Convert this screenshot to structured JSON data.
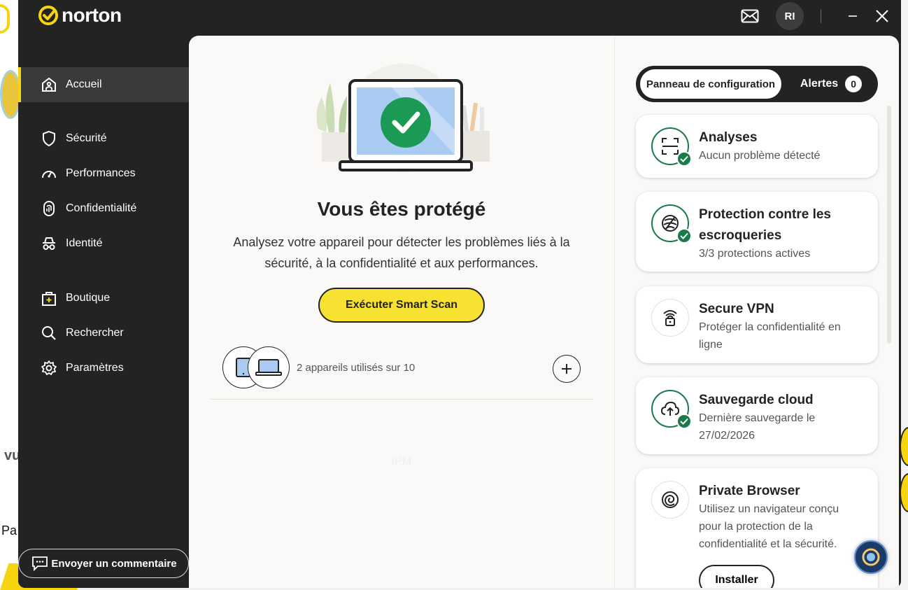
{
  "app": {
    "brand": "norton",
    "user_initials": "RI"
  },
  "sidebar": {
    "items": [
      {
        "label": "Accueil",
        "icon": "home-icon"
      },
      {
        "label": "Sécurité",
        "icon": "shield-icon"
      },
      {
        "label": "Performances",
        "icon": "speedometer-icon"
      },
      {
        "label": "Confidentialité",
        "icon": "fingerprint-icon"
      },
      {
        "label": "Identité",
        "icon": "incognito-icon"
      },
      {
        "label": "Boutique",
        "icon": "shopping-bag-icon"
      },
      {
        "label": "Rechercher",
        "icon": "search-icon"
      },
      {
        "label": "Paramètres",
        "icon": "gear-icon"
      }
    ],
    "feedback_label": "Envoyer un commentaire"
  },
  "main": {
    "title": "Vous êtes protégé",
    "description": "Analysez votre appareil pour détecter les problèmes liés à la sécurité, à la confidentialité et aux performances.",
    "scan_button": "Exécuter Smart Scan",
    "devices_text": "2 appareils utilisés sur 10",
    "ipm_text": "IPM"
  },
  "right": {
    "toggle_left": "Panneau de configuration",
    "toggle_right": "Alertes",
    "alerts_count": "0",
    "cards": [
      {
        "title": "Analyses",
        "subtitle": "Aucun problème détecté"
      },
      {
        "title": "Protection contre les escroqueries",
        "subtitle": "3/3 protections actives"
      },
      {
        "title": "Secure VPN",
        "subtitle": "Protéger la confidentialité en ligne"
      },
      {
        "title": "Sauvegarde cloud",
        "subtitle": "Dernière sauvegarde le 27/02/2026"
      },
      {
        "title": "Private Browser",
        "subtitle": "Utilisez un navigateur conçu pour la protection de la confidentialité et la sécurité.",
        "button": "Installer"
      }
    ]
  },
  "background": {
    "text1": "vu",
    "text2": "Pa"
  },
  "colors": {
    "accent_yellow": "#f7d50e",
    "success_green": "#1a7a4a",
    "dark": "#232323"
  }
}
